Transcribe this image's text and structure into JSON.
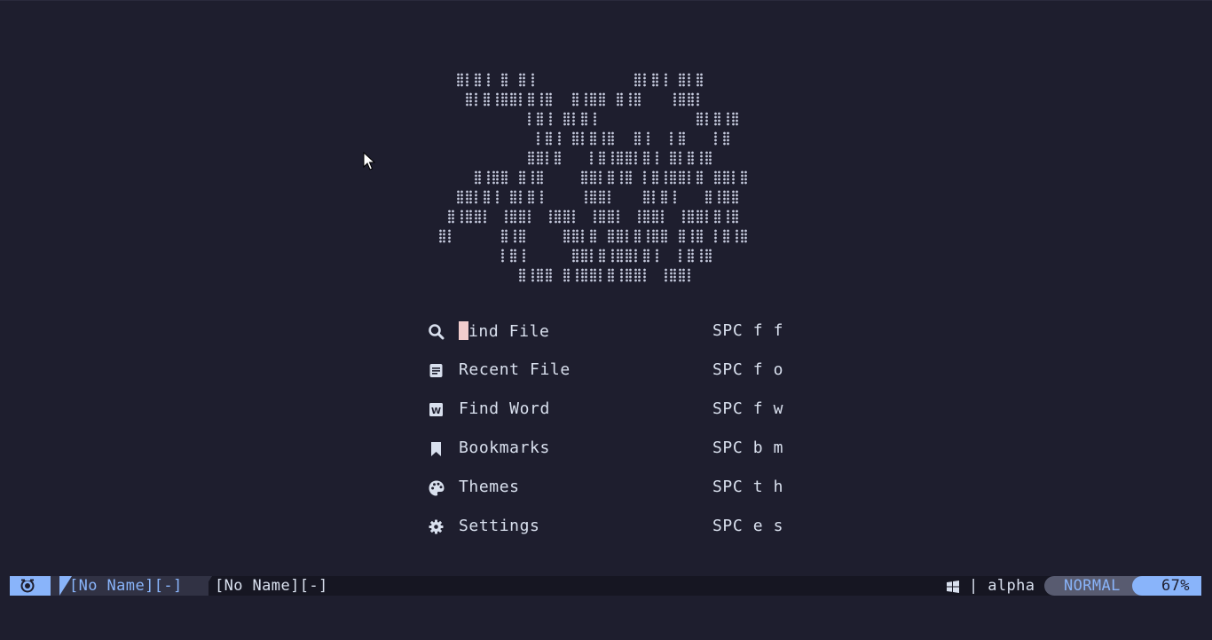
{
  "dashboard": {
    "menu": [
      {
        "icon": "search-icon",
        "label": "Find File",
        "key": "SPC f f"
      },
      {
        "icon": "file-text-icon",
        "label": "Recent File",
        "key": "SPC f o"
      },
      {
        "icon": "word-icon",
        "label": "Find Word",
        "key": "SPC f w"
      },
      {
        "icon": "bookmark-icon",
        "label": "Bookmarks",
        "key": "SPC b m"
      },
      {
        "icon": "palette-icon",
        "label": "Themes",
        "key": "SPC t h"
      },
      {
        "icon": "gear-icon",
        "label": "Settings",
        "key": "SPC e s"
      }
    ],
    "first_label_cursor_char": "F",
    "first_label_rest": "ind File"
  },
  "statusline": {
    "mode_icon": "vim-icon",
    "active_file": "[No Name][-]",
    "inactive_file": "[No Name][-]",
    "os_icon": "windows-icon",
    "filetype": "| alpha",
    "mode": "NORMAL",
    "progress": "67%"
  },
  "colors": {
    "background": "#1e1e2e",
    "text": "#d9e0ee",
    "accent": "#89b4fa",
    "cursor": "#f2cdcd",
    "mode_bg": "#585b70"
  }
}
